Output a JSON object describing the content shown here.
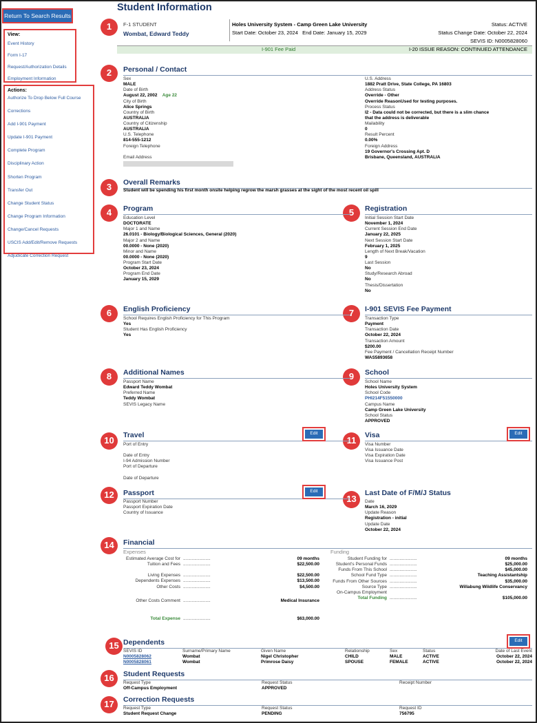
{
  "title": "Student Information",
  "nav": {
    "return_button": "Return To Search Results",
    "view_heading": "View:",
    "view_items": [
      "Event History",
      "Form I-17",
      "Request/Authorization Details",
      "Employment Information"
    ],
    "actions_heading": "Actions:",
    "action_items": [
      "Authorize To Drop Below Full Course",
      "Corrections",
      "Add I-901 Payment",
      "Update I-901 Payment",
      "Complete Program",
      "Disciplinary Action",
      "Shorten Program",
      "Transfer Out",
      "Change Student Status",
      "Change Program Information",
      "Change/Cancel Requests",
      "USCIS Add/Edit/Remove Requests",
      "Adjudicate Correction Request"
    ]
  },
  "badges": [
    "1",
    "2",
    "3",
    "4",
    "5",
    "6",
    "7",
    "8",
    "9",
    "10",
    "11",
    "12",
    "13",
    "14",
    "15",
    "16",
    "17"
  ],
  "header": {
    "student_type": "F-1 STUDENT",
    "name": "Wombat, Edward Teddy",
    "school": "Holes University System - Camp Green Lake University",
    "start": "Start Date: October 23, 2024",
    "end": "End Date: January 15, 2029",
    "status": "Status: ACTIVE",
    "status_change": "Status Change Date: October 22, 2024",
    "sevis_id": "SEVIS ID: N0005828060",
    "fee": "I-901 Fee Paid",
    "issue": "I-20 ISSUE REASON: CONTINUED ATTENDANCE"
  },
  "personal": {
    "title": "Personal / Contact",
    "left": [
      [
        "Sex",
        "MALE"
      ],
      [
        "Date of Birth",
        "August 22, 2002"
      ],
      [
        "City of Birth",
        "Alice Springs"
      ],
      [
        "Country of Birth",
        "AUSTRALIA"
      ],
      [
        "Country of Citizenship",
        "AUSTRALIA"
      ],
      [
        "U.S. Telephone",
        "814-555-1212"
      ],
      [
        "Foreign Telephone",
        ""
      ],
      [
        "Email Address",
        ""
      ]
    ],
    "age": "Age 22",
    "right": [
      [
        "U.S. Address",
        "1882 Pratt Drive,  State College,  PA 16803"
      ],
      [
        "Address Status",
        "Override - Other"
      ],
      [
        "",
        "Override ReasonUsed for testing purposes."
      ],
      [
        "Process Status",
        "I2 - Data could not be corrected, but there is a slim chance"
      ],
      [
        "",
        "that the address is deliverable"
      ],
      [
        "Mailability",
        "0"
      ],
      [
        "Result Percent",
        "0.00%"
      ],
      [
        "Foreign Address",
        "19 Governor's Crossing Apt. D"
      ],
      [
        "",
        "Brisbane,  Queensland,  AUSTRALIA"
      ]
    ]
  },
  "remarks": {
    "title": "Overall Remarks",
    "text": "Student will be spending his first month onsite helping regrow the marsh grasses at the sight of the most recent oil spill"
  },
  "program": {
    "title": "Program",
    "fields": [
      [
        "Education Level",
        "DOCTORATE"
      ],
      [
        "Major 1 and Name",
        "26.0101 - Biology/Biological Sciences, General (2020)"
      ],
      [
        "Major 2 and Name",
        "00.0000 - None (2020)"
      ],
      [
        "Minor and Name",
        "00.0000 - None (2020)"
      ],
      [
        "Program Start Date",
        "October 23, 2024"
      ],
      [
        "Program End Date",
        "January 15, 2029"
      ]
    ]
  },
  "registration": {
    "title": "Registration",
    "fields": [
      [
        "Initial Session Start Date",
        "November 1, 2024"
      ],
      [
        "Current Session End Date",
        "January 22, 2025"
      ],
      [
        "Next Session Start Date",
        "February 1, 2025"
      ],
      [
        "Length of Next Break/Vacation",
        "9"
      ],
      [
        "Last Session",
        "No"
      ],
      [
        "Study/Research Abroad",
        "No"
      ],
      [
        "Thesis/Dissertation",
        "No"
      ]
    ]
  },
  "english": {
    "title": "English Proficiency",
    "fields": [
      [
        "School Requires English Proficiency for This Program",
        "Yes"
      ],
      [
        "Student Has English Proficiency",
        "Yes"
      ]
    ]
  },
  "sevis_fee": {
    "title": "I-901 SEVIS Fee Payment",
    "fields": [
      [
        "Transaction Type",
        "Payment"
      ],
      [
        "Transaction Date",
        "October 22, 2024"
      ],
      [
        "Transaction Amount",
        "$200.00"
      ],
      [
        "Fee Payment / Cancellation Receipt Number",
        "WAS5893658"
      ]
    ]
  },
  "names": {
    "title": "Additional Names",
    "fields": [
      [
        "Passport Name",
        "Edward Teddy Wombat"
      ],
      [
        "Preferred Name",
        "Teddy Wombat"
      ],
      [
        "SEVIS Legacy Name",
        ""
      ]
    ]
  },
  "school": {
    "title": "School",
    "fields": [
      [
        "School Name",
        "Holes University System"
      ],
      [
        "School Code",
        "PHI214F51550000"
      ],
      [
        "Campus Name",
        "Camp Green Lake University"
      ],
      [
        "School Status",
        "APPROVED"
      ]
    ]
  },
  "travel": {
    "title": "Travel",
    "edit": "Edit",
    "labels": [
      "Port of Entry",
      "Date of Entry",
      "I-94 Admission Number",
      "Port of Departure",
      "Date of Departure"
    ]
  },
  "visa": {
    "title": "Visa",
    "edit": "Edit",
    "labels": [
      "Visa Number",
      "Visa Issuance Date",
      "Visa Expiration Date",
      "Visa Issuance Post"
    ]
  },
  "passport": {
    "title": "Passport",
    "edit": "Edit",
    "labels": [
      "Passport Number",
      "Passport Expiration Date",
      "Country of Issuance"
    ]
  },
  "last_date": {
    "title": "Last Date of F/M/J Status",
    "fields": [
      [
        "Date",
        "March 16, 2029"
      ],
      [
        "Update Reason",
        "Registration - initial"
      ],
      [
        "Update Date",
        "October 22, 2024"
      ]
    ]
  },
  "financial": {
    "title": "Financial",
    "expenses_h": "Expenses",
    "funding_h": "Funding",
    "dots": "......................",
    "expenses": [
      [
        "Estimated Average Cost for",
        "09 months"
      ],
      [
        "Tuition and Fees",
        "$22,500.00"
      ],
      [
        "Living Expenses",
        "$22,500.00"
      ],
      [
        "Dependents Expenses",
        "$13,500.00"
      ],
      [
        "Other Costs",
        "$4,500.00"
      ],
      [
        "Other Costs Comment",
        "Medical Insurance"
      ],
      [
        "Total Expense",
        "$63,000.00"
      ]
    ],
    "funding": [
      [
        "Student Funding for",
        "09 months"
      ],
      [
        "Student's Personal Funds",
        "$25,000.00"
      ],
      [
        "Funds From This School",
        "$45,000.00"
      ],
      [
        "School Fund Type",
        "Teaching Assistantship"
      ],
      [
        "Funds From Other Sources",
        "$35,000.00"
      ],
      [
        "Source Type",
        "Willabung Wildlife Conservancy"
      ],
      [
        "On-Campus Employment",
        ""
      ],
      [
        "Total Funding",
        "$105,000.00"
      ]
    ]
  },
  "dependents": {
    "title": "Dependents",
    "edit": "Edit",
    "columns": [
      "SEVIS ID",
      "Surname/Primary Name",
      "Given Name",
      "Relationship",
      "Sex",
      "Status",
      "Date of Last Event"
    ],
    "rows": [
      [
        "N0005828062",
        "Wombat",
        "Nigel Christopher",
        "CHILD",
        "MALE",
        "ACTIVE",
        "October 22, 2024"
      ],
      [
        "N0005828061",
        "Wombat",
        "Primrose Daisy",
        "SPOUSE",
        "FEMALE",
        "ACTIVE",
        "October 22, 2024"
      ]
    ]
  },
  "student_requests": {
    "title": "Student Requests",
    "columns": [
      "Request Type",
      "Request Status",
      "Receipt Number"
    ],
    "row": [
      "Off-Campus Employment",
      "APPROVED",
      ""
    ]
  },
  "correction_requests": {
    "title": "Correction Requests",
    "columns": [
      "Request Type",
      "Request Status",
      "Request ID"
    ],
    "row": [
      "Student Request Change",
      "PENDING",
      "756795"
    ]
  }
}
